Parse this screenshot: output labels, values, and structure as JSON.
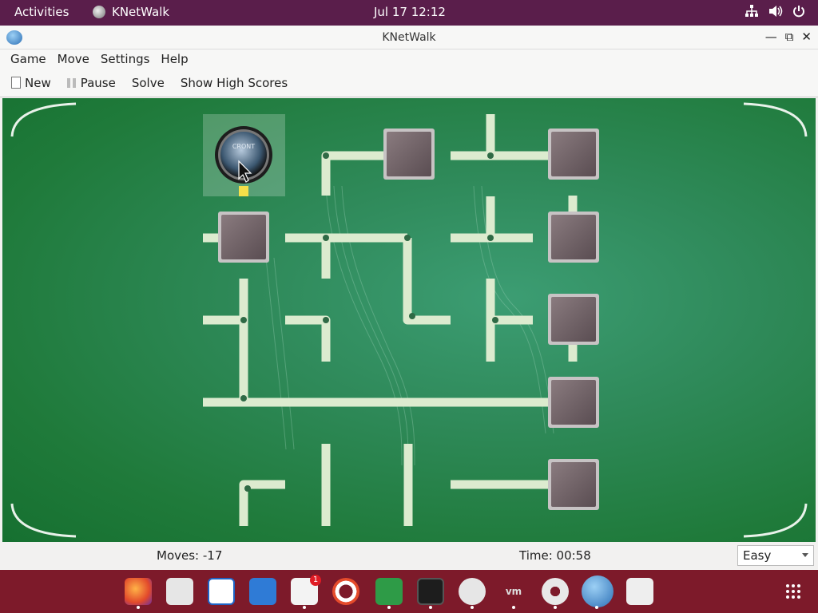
{
  "topbar": {
    "activities": "Activities",
    "app_name": "KNetWalk",
    "clock": "Jul 17  12:12"
  },
  "window": {
    "title": "KNetWalk"
  },
  "menu": {
    "game": "Game",
    "move": "Move",
    "settings": "Settings",
    "help": "Help"
  },
  "toolbar": {
    "new": "New",
    "pause": "Pause",
    "solve": "Solve",
    "high_scores": "Show High Scores"
  },
  "status": {
    "moves": "Moves: -17",
    "time": "Time: 00:58",
    "difficulty": "Easy"
  },
  "board": {
    "server_label": "CRONT"
  },
  "dock": {
    "apps": [
      "firefox",
      "evolution",
      "writer",
      "document",
      "software",
      "help",
      "game",
      "terminal",
      "robot",
      "vmware",
      "settings",
      "knetwalk",
      "trash"
    ],
    "badge": "1"
  },
  "colors": {
    "topbar": "#5a1e4b",
    "dock": "#7d1a2a",
    "board": "#2f8a5a",
    "wire": "#dcebcf",
    "wire_active": "#f4e04a"
  }
}
